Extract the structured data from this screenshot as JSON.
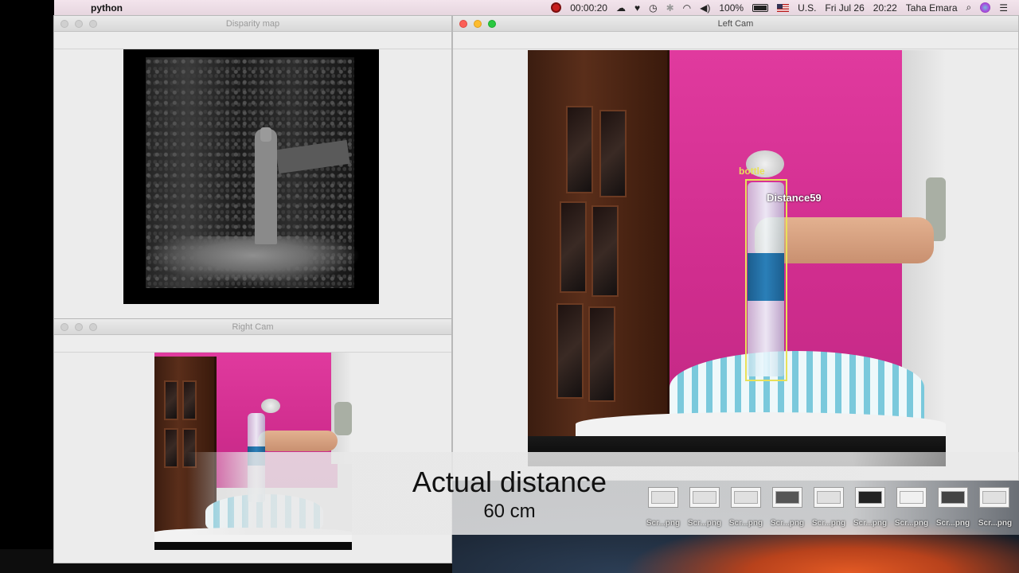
{
  "menubar": {
    "app_name": "python",
    "recording_time": "00:00:20",
    "battery": "100%",
    "input_source": "U.S.",
    "date": "Fri Jul 26",
    "time": "20:22",
    "user": "Taha Emara"
  },
  "windows": {
    "disparity": {
      "title": "Disparity map"
    },
    "right_cam": {
      "title": "Right Cam"
    },
    "left_cam": {
      "title": "Left Cam"
    }
  },
  "detection": {
    "class_label": "bottle",
    "distance_label": "Distance59",
    "box_color": "#e8e15a"
  },
  "caption": {
    "title": "Actual distance",
    "value": "60 cm"
  },
  "thumbnails": [
    {
      "label": "Scr...png"
    },
    {
      "label": "Scr...png"
    },
    {
      "label": "Scr...png"
    },
    {
      "label": "Scr...png"
    },
    {
      "label": "Scr...png"
    },
    {
      "label": "Scr...png"
    },
    {
      "label": "Scr...png"
    },
    {
      "label": "Scr...png"
    },
    {
      "label": "Scr...png"
    }
  ],
  "colors": {
    "wall": "#d02d8e",
    "record": "#c81e1e"
  }
}
